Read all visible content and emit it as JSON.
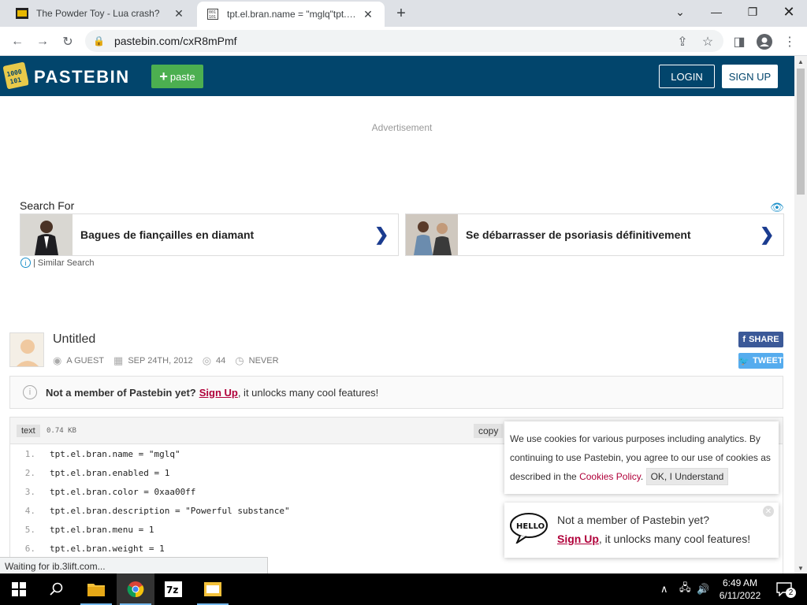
{
  "browser": {
    "tabs": [
      {
        "title": "The Powder Toy - Lua crash?",
        "active": false
      },
      {
        "title": "tpt.el.bran.name = \"mglq\"tpt.el.b",
        "active": true
      }
    ],
    "url": "pastebin.com/cxR8mPmf",
    "status_text": "Waiting for ib.3lift.com..."
  },
  "pastebin": {
    "brand": "PASTEBIN",
    "paste_button": "paste",
    "login": "LOGIN",
    "signup": "SIGN UP"
  },
  "ad": {
    "label": "Advertisement",
    "search_for": "Search For",
    "cards": [
      {
        "text": "Bagues de fiançailles en diamant"
      },
      {
        "text": "Se débarrasser de psoriasis définitivement"
      }
    ],
    "similar": "| Similar Search"
  },
  "paste": {
    "title": "Untitled",
    "author": "A GUEST",
    "date": "SEP 24TH, 2012",
    "views": "44",
    "expiry": "NEVER",
    "share": "SHARE",
    "tweet": "TWEET",
    "lang": "text",
    "size": "0.74 KB",
    "copy": "copy",
    "lines": [
      {
        "num": "1.",
        "src": "tpt.el.bran.name = \"mglq\""
      },
      {
        "num": "2.",
        "src": "tpt.el.bran.enabled = 1"
      },
      {
        "num": "3.",
        "src": "tpt.el.bran.color = 0xaa00ff"
      },
      {
        "num": "4.",
        "src": "tpt.el.bran.description = \"Powerful substance\""
      },
      {
        "num": "5.",
        "src": "tpt.el.bran.menu = 1"
      },
      {
        "num": "6.",
        "src": "tpt.el.bran.weight = 1"
      }
    ]
  },
  "notice": {
    "bold": "Not a member of Pastebin yet?",
    "link": "Sign Up",
    "rest": ", it unlocks many cool features!"
  },
  "cookie": {
    "text": "We use cookies for various purposes including analytics. By continuing to use Pastebin, you agree to our use of cookies as described in the",
    "link": "Cookies Policy",
    "period": ".",
    "button": "OK, I Understand"
  },
  "member_popup": {
    "line1": "Not a member of Pastebin yet?",
    "link": "Sign Up",
    "rest": ", it unlocks many cool features!"
  },
  "taskbar": {
    "time": "6:49 AM",
    "date": "6/11/2022",
    "notifications": "2"
  },
  "colors": {
    "pastebin_header": "#02456c",
    "paste_green": "#4caf50",
    "link_red": "#b0003a"
  }
}
